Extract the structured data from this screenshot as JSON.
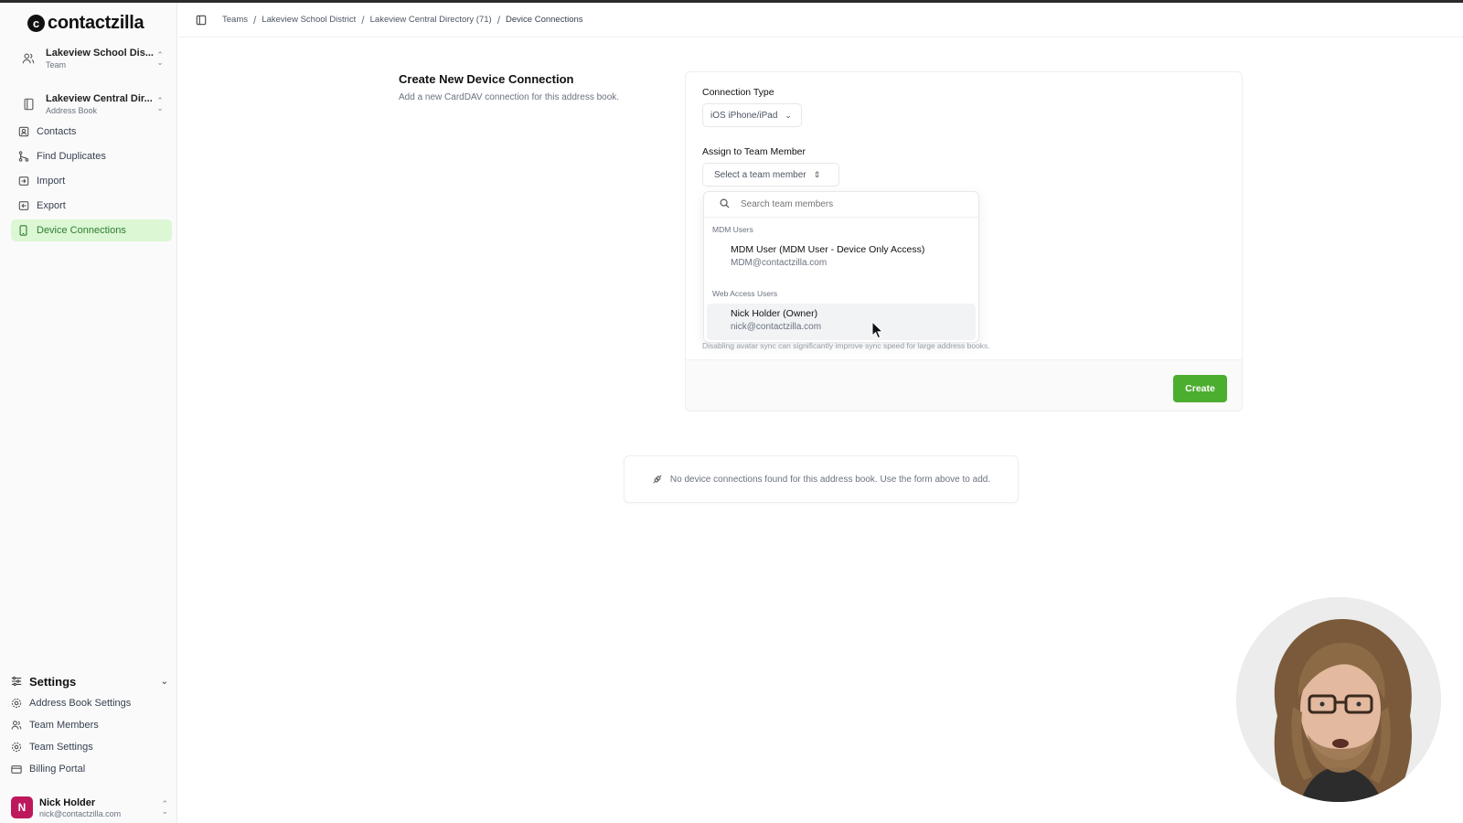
{
  "app": {
    "logo_text": "contactzilla",
    "logo_mark": "c"
  },
  "sidebar": {
    "team_switcher": {
      "title": "Lakeview School Dis...",
      "subtitle": "Team"
    },
    "book_switcher": {
      "title": "Lakeview Central Dir...",
      "subtitle": "Address Book"
    },
    "items": [
      {
        "label": "Contacts",
        "icon": "contacts-icon"
      },
      {
        "label": "Find Duplicates",
        "icon": "merge-icon"
      },
      {
        "label": "Import",
        "icon": "import-icon"
      },
      {
        "label": "Export",
        "icon": "export-icon"
      },
      {
        "label": "Device Connections",
        "icon": "device-icon",
        "active": true
      }
    ],
    "settings": {
      "label": "Settings",
      "items": [
        {
          "label": "Address Book Settings",
          "icon": "gear-icon"
        },
        {
          "label": "Team Members",
          "icon": "users-icon"
        },
        {
          "label": "Team Settings",
          "icon": "gear-icon"
        },
        {
          "label": "Billing Portal",
          "icon": "credit-card-icon"
        }
      ]
    },
    "user": {
      "initial": "N",
      "name": "Nick Holder",
      "email": "nick@contactzilla.com"
    }
  },
  "breadcrumb": [
    "Teams",
    "Lakeview School District",
    "Lakeview Central Directory (71)",
    "Device Connections"
  ],
  "form": {
    "title": "Create New Device Connection",
    "subtitle": "Add a new CardDAV connection for this address book.",
    "connection_type_label": "Connection Type",
    "connection_type_value": "iOS iPhone/iPad",
    "assign_label": "Assign to Team Member",
    "assign_placeholder": "Select a team member",
    "helper_text": "Disabling avatar sync can significantly improve sync speed for large address books.",
    "create_label": "Create"
  },
  "dropdown": {
    "search_placeholder": "Search team members",
    "groups": [
      {
        "label": "MDM Users",
        "items": [
          {
            "name": "MDM User (MDM User - Device Only Access)",
            "email": "MDM@contactzilla.com"
          }
        ]
      },
      {
        "label": "Web Access Users",
        "items": [
          {
            "name": "Nick Holder (Owner)",
            "email": "nick@contactzilla.com",
            "hovered": true
          }
        ]
      }
    ]
  },
  "empty_state": {
    "text": "No device connections found for this address book. Use the form above to add."
  },
  "colors": {
    "accent": "#4cae2f",
    "active_bg": "#dcf7d4",
    "active_text": "#2e7d32",
    "avatar": "#be185d"
  }
}
